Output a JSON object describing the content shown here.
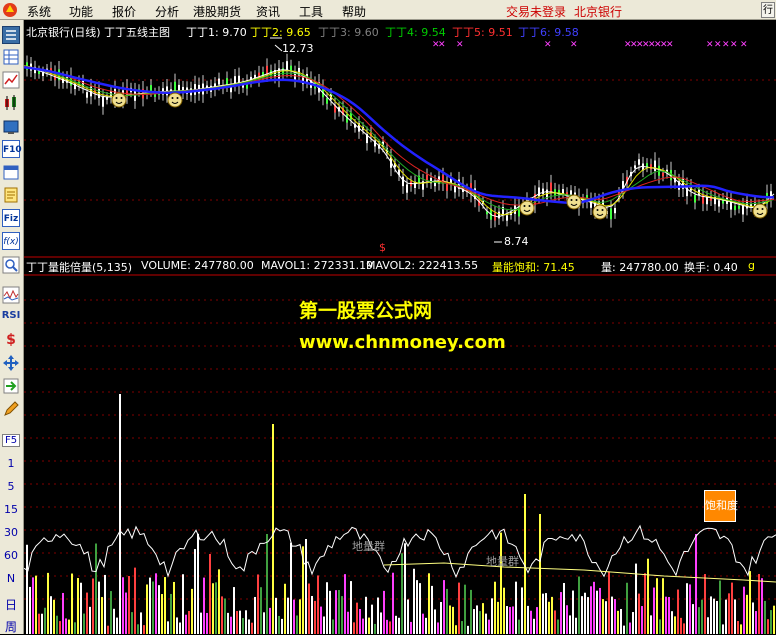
{
  "menu": {
    "items": [
      "系统",
      "功能",
      "报价",
      "分析",
      "港股期货",
      "资讯",
      "工具",
      "帮助"
    ],
    "status_login": "交易未登录",
    "status_stock": "北京银行",
    "close_label": "行"
  },
  "toolbar": {
    "text_buttons": [
      "RSI",
      "F5",
      "1",
      "5",
      "15",
      "30",
      "60",
      "N",
      "日",
      "周"
    ]
  },
  "main_chart": {
    "title": "北京银行(日线)",
    "indicator_name": "丁丁五线主图",
    "lines": [
      {
        "label": "丁丁1: 9.70",
        "color": "#ffffff"
      },
      {
        "label": "丁丁2: 9.65",
        "color": "#ffff00"
      },
      {
        "label": "丁丁3: 9.60",
        "color": "#808080"
      },
      {
        "label": "丁丁4: 9.54",
        "color": "#00cc00"
      },
      {
        "label": "丁丁5: 9.51",
        "color": "#ff3030"
      },
      {
        "label": "丁丁6: 9.58",
        "color": "#4040ff"
      }
    ],
    "high_label": "12.73",
    "low_label": "8.74",
    "dollar_marker": "$"
  },
  "sub_chart": {
    "indicator_name": "丁丁量能倍量(5,135)",
    "volume": "VOLUME: 247780.00",
    "mavol1": "MAVOL1: 272331.19",
    "mavol2": "MAVOL2: 222413.55",
    "saturation": "量能饱和: 71.45",
    "vol_right": "量: 247780.00",
    "turnover": "换手: 0.40",
    "turnover_suffix": "g",
    "saturation_box": "饱和度",
    "ground_labels": [
      "地量群",
      "地量群"
    ]
  },
  "watermark": {
    "line1": "第一股票公式网",
    "line2": "www.chnmoney.com"
  },
  "colors": {
    "ma_blue": "#2222ff",
    "ma_red": "#dd2222",
    "ma_green": "#22aa22",
    "ma_yellow": "#dddd00",
    "ma_white": "#ffffff",
    "volume_white": "#ffffff",
    "volume_yellow": "#ffff40",
    "volume_magenta": "#ff40ff",
    "grid_red": "#800000",
    "status_red": "#cc0000",
    "watermark_yellow": "#ffff00",
    "saturation_orange": "#ff8800"
  }
}
